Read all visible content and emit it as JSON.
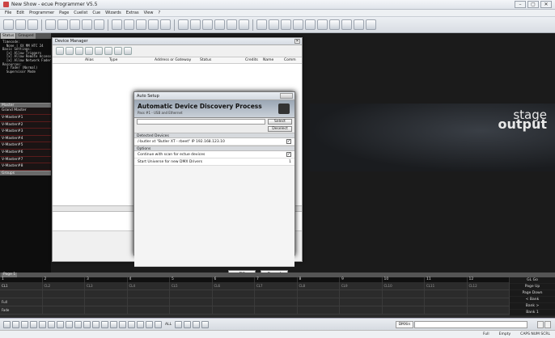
{
  "window": {
    "title": "New Show - ecue Programmer V5.5"
  },
  "menu": [
    "File",
    "Edit",
    "Programmer",
    "Page",
    "Cuelist",
    "Cue",
    "Wizards",
    "Extras",
    "View",
    "?"
  ],
  "left_panel": {
    "status_tabs": [
      "Status",
      "Grouped",
      "Screen 1",
      "Screen 2"
    ],
    "status_tree": "Timecode:\n  None | XX MM HTC 24\nBasic Settings:\n  [x] Allow Triggers\n  [x] Allow Remote Access\n  [x] Allow Network Fader\nResources:\n  1 fader (Normal)\n  Supervisor Mode",
    "master_header": "Master",
    "masters": [
      "Grand Master",
      "V-Master#1",
      "V-Master#2",
      "V-Master#3",
      "V-Master#4",
      "V-Master#5",
      "V-Master#6",
      "V-Master#7",
      "V-Master#8"
    ],
    "groups_header": "Groups"
  },
  "stage_output": {
    "line1": "stage",
    "line2": "output"
  },
  "device_manager": {
    "title": "Device Manager",
    "columns": [
      "Alias",
      "Type",
      "Address or Gateway",
      "Status",
      "Credits",
      "Name",
      "Comm"
    ]
  },
  "auto_setup": {
    "title": "Auto Setup",
    "heading": "Automatic Device Discovery Process",
    "subheading": "Pass #1 - USB and Ethernet",
    "select_label": "Select",
    "deselect_label": "Deselect",
    "detected_group": "Detected Devices",
    "detected_device": "/-butler xt \"Butler XT - rbeet\" IP 192.168.123.10",
    "options_group": "Options",
    "option_continue": "Continue with scan for ectue devices",
    "option_universe": "Start Universe for new DMX Drivers",
    "universe_value": "1",
    "ok_label": "OK",
    "cancel_label": "Cancel"
  },
  "bottom": {
    "page_tab": "Page 1",
    "fader_headers": [
      "1",
      "2",
      "3",
      "4",
      "5",
      "6",
      "7",
      "8",
      "9",
      "10",
      "11",
      "12"
    ],
    "row1_label": "CL1",
    "row1_cells": [
      "CL2",
      "CL3",
      "CL4",
      "CL5",
      "CL6",
      "CL7",
      "CL8",
      "CL9",
      "CL10",
      "CL11",
      "CL12"
    ],
    "row2_label": "",
    "row3_label": "Full",
    "row4_label": "Fade",
    "right_buttons": [
      "GL Go",
      "Page Up",
      "Page Down",
      "< Bank",
      "Bank >",
      "Bank 1"
    ]
  },
  "bottom_toolbar": {
    "all_label": "ALL",
    "dmx_label": "DMXin"
  },
  "statusbar": {
    "mode": "Full",
    "state": "Empty",
    "keys": "CAPS NUM SCRL"
  }
}
